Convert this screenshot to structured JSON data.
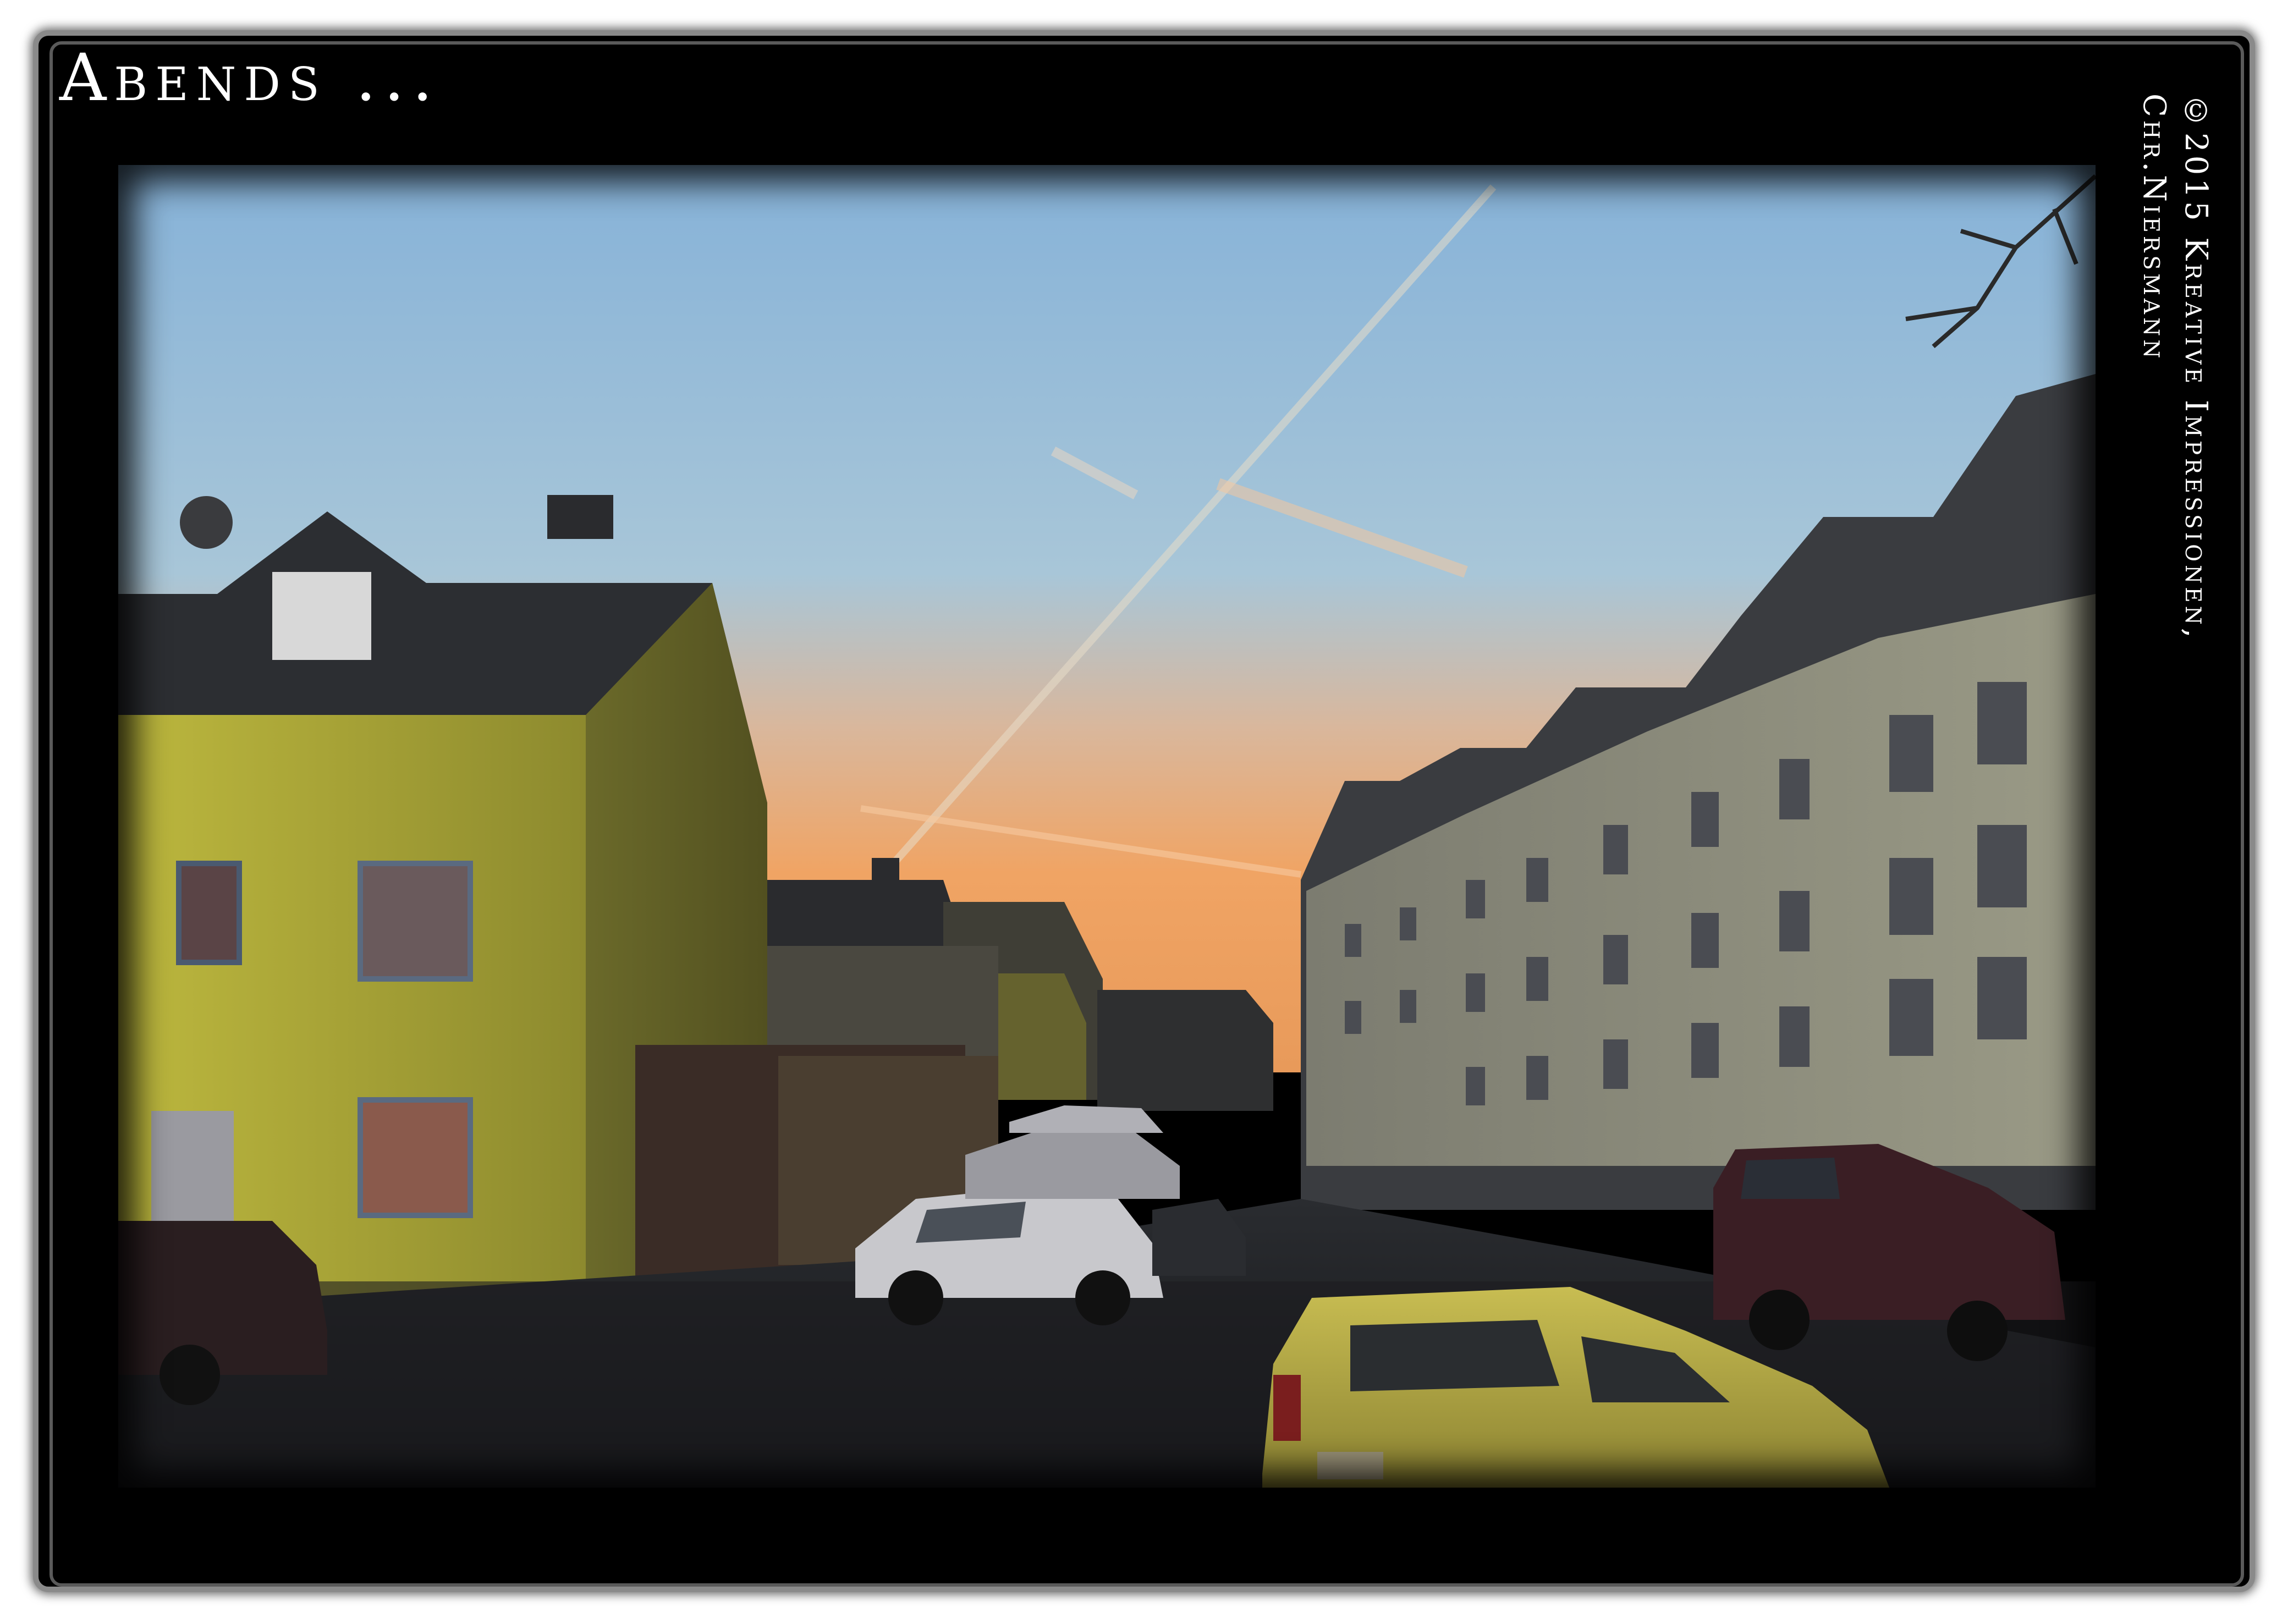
{
  "title": "Abends ...",
  "copyright": {
    "line1": "©2015 Kreative Impressionen,",
    "line2": "Chr.Niersmann"
  },
  "photo": {
    "subject": "evening street",
    "colors": {
      "sky_top": "#8fb6d8",
      "sky_horizon": "#f0a86a",
      "yellow_house": "#b9b53c",
      "apartment": "#8a8a78",
      "asphalt": "#1e2024",
      "frame": "#000000"
    }
  }
}
